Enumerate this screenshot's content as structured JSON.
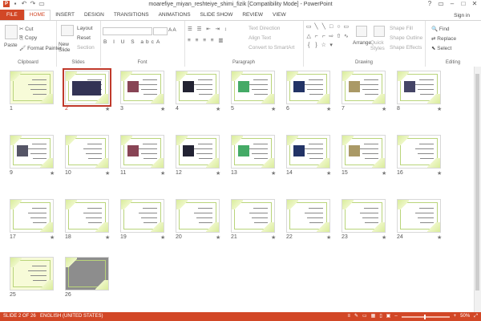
{
  "window": {
    "title": "moarefiye_miyan_reshteiye_shimi_fizik [Compatibility Mode] - PowerPoint"
  },
  "tabs": [
    "FILE",
    "HOME",
    "INSERT",
    "DESIGN",
    "TRANSITIONS",
    "ANIMATIONS",
    "SLIDE SHOW",
    "REVIEW",
    "VIEW"
  ],
  "signin": "Sign in",
  "clipboard": {
    "paste": "Paste",
    "cut": "Cut",
    "copy": "Copy",
    "format_painter": "Format Painter",
    "label": "Clipboard"
  },
  "slides_group": {
    "new_slide": "New Slide",
    "layout": "Layout",
    "reset": "Reset",
    "section": "Section",
    "label": "Slides"
  },
  "font_group": {
    "label": "Font"
  },
  "paragraph_group": {
    "text_direction": "Text Direction",
    "align_text": "Align Text",
    "convert": "Convert to SmartArt",
    "label": "Paragraph"
  },
  "drawing_group": {
    "arrange": "Arrange",
    "quick_styles": "Quick Styles",
    "shape_fill": "Shape Fill",
    "shape_outline": "Shape Outline",
    "shape_effects": "Shape Effects",
    "label": "Drawing"
  },
  "editing_group": {
    "find": "Find",
    "replace": "Replace",
    "select": "Select",
    "label": "Editing"
  },
  "slides": [
    {
      "n": "1",
      "star": false
    },
    {
      "n": "2",
      "star": true
    },
    {
      "n": "3",
      "star": true
    },
    {
      "n": "4",
      "star": true
    },
    {
      "n": "5",
      "star": true
    },
    {
      "n": "6",
      "star": true
    },
    {
      "n": "7",
      "star": true
    },
    {
      "n": "8",
      "star": true
    },
    {
      "n": "9",
      "star": true
    },
    {
      "n": "10",
      "star": true
    },
    {
      "n": "11",
      "star": true
    },
    {
      "n": "12",
      "star": true
    },
    {
      "n": "13",
      "star": true
    },
    {
      "n": "14",
      "star": true
    },
    {
      "n": "15",
      "star": true
    },
    {
      "n": "16",
      "star": true
    },
    {
      "n": "17",
      "star": true
    },
    {
      "n": "18",
      "star": true
    },
    {
      "n": "19",
      "star": true
    },
    {
      "n": "20",
      "star": true
    },
    {
      "n": "21",
      "star": true
    },
    {
      "n": "22",
      "star": true
    },
    {
      "n": "23",
      "star": true
    },
    {
      "n": "24",
      "star": true
    },
    {
      "n": "25",
      "star": false
    },
    {
      "n": "26",
      "star": false
    }
  ],
  "status": {
    "slide": "SLIDE 2 OF 26",
    "language": "ENGLISH (UNITED STATES)",
    "zoom": "50%"
  }
}
